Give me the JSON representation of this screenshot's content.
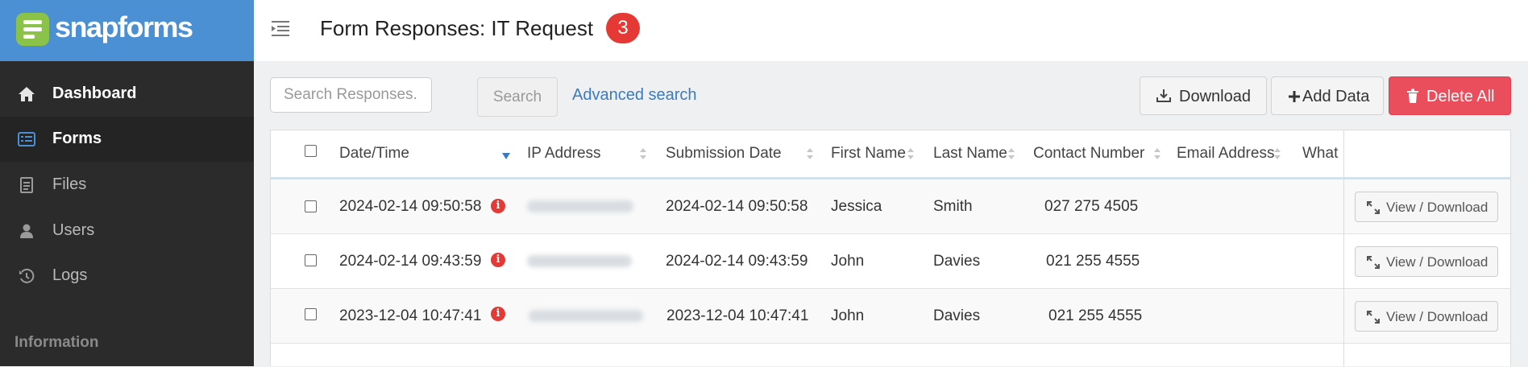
{
  "brand": {
    "name": "snapforms"
  },
  "sidebar": {
    "items": [
      {
        "label": "Dashboard",
        "icon": "home-icon"
      },
      {
        "label": "Forms",
        "icon": "forms-icon"
      },
      {
        "label": "Files",
        "icon": "file-icon"
      },
      {
        "label": "Users",
        "icon": "user-icon"
      },
      {
        "label": "Logs",
        "icon": "history-icon"
      }
    ],
    "section_label": "Information"
  },
  "header": {
    "title": "Form Responses: IT Request",
    "badge_count": "3"
  },
  "toolbar": {
    "search_placeholder": "Search Responses..",
    "search_label": "Search",
    "advanced_search_label": "Advanced search",
    "download_label": "Download",
    "add_data_label": "Add Data",
    "delete_all_label": "Delete All"
  },
  "table": {
    "columns": [
      "Date/Time",
      "IP Address",
      "Submission Date",
      "First Name",
      "Last Name",
      "Contact Number",
      "Email Address",
      "What"
    ],
    "sorted_column": "Date/Time",
    "sort_direction": "descending",
    "rows": [
      {
        "datetime": "2024-02-14 09:50:58",
        "submission_date": "2024-02-14 09:50:58",
        "first_name": "Jessica",
        "last_name": "Smith",
        "contact": "027 275 4505",
        "action": "View / Download"
      },
      {
        "datetime": "2024-02-14 09:43:59",
        "submission_date": "2024-02-14 09:43:59",
        "first_name": "John",
        "last_name": "Davies",
        "contact": "021 255 4555",
        "action": "View / Download"
      },
      {
        "datetime": "2023-12-04 10:47:41",
        "submission_date": "2023-12-04 10:47:41",
        "first_name": "John",
        "last_name": "Davies",
        "contact": "021 255 4555",
        "action": "View / Download"
      }
    ]
  },
  "colors": {
    "brand_blue": "#4a90d2",
    "danger": "#ea4e5c",
    "sidebar_bg": "#2b2b2b",
    "link": "#3b7bbf"
  }
}
